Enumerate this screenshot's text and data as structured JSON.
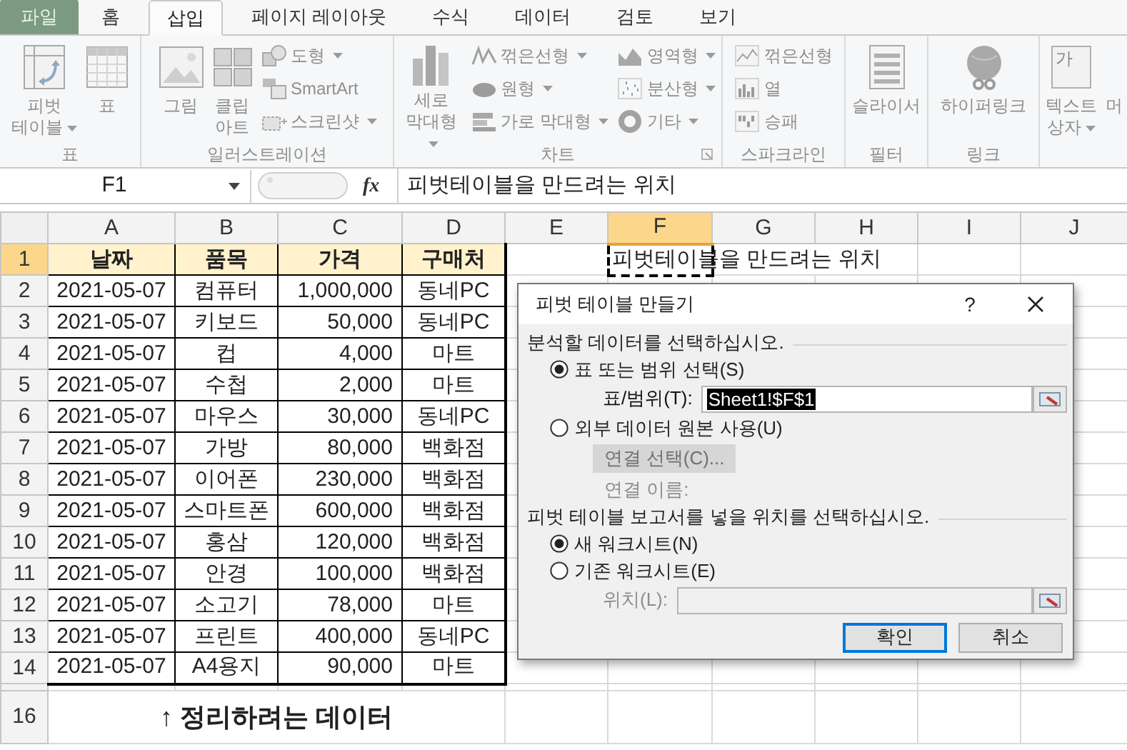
{
  "ribbon": {
    "disabled": true,
    "tabs": [
      {
        "label": "파일",
        "kind": "file",
        "selected": false
      },
      {
        "label": "홈",
        "kind": "tab",
        "selected": false
      },
      {
        "label": "삽입",
        "kind": "tab",
        "selected": true
      },
      {
        "label": "페이지 레이아웃",
        "kind": "tab",
        "selected": false
      },
      {
        "label": "수식",
        "kind": "tab",
        "selected": false
      },
      {
        "label": "데이터",
        "kind": "tab",
        "selected": false
      },
      {
        "label": "검토",
        "kind": "tab",
        "selected": false
      },
      {
        "label": "보기",
        "kind": "tab",
        "selected": false
      }
    ],
    "groups": [
      {
        "label": "표",
        "tools": [
          {
            "label": "피벗\n테이블",
            "kind": "large",
            "dropdown": true
          },
          {
            "label": "표",
            "kind": "large",
            "dropdown": false
          }
        ]
      },
      {
        "label": "일러스트레이션",
        "tools": [
          {
            "label": "그림",
            "kind": "large",
            "dropdown": false
          },
          {
            "label": "클립\n아트",
            "kind": "large",
            "dropdown": false
          },
          {
            "label": "도형",
            "kind": "small",
            "dropdown": true
          },
          {
            "label": "SmartArt",
            "kind": "small",
            "dropdown": false
          },
          {
            "label": "스크린샷",
            "kind": "small",
            "dropdown": true
          }
        ]
      },
      {
        "label": "차트",
        "launcher": true,
        "tools": [
          {
            "label": "세로\n막대형",
            "kind": "large",
            "dropdown": true
          },
          {
            "label": "꺾은선형",
            "kind": "small",
            "dropdown": true
          },
          {
            "label": "원형",
            "kind": "small",
            "dropdown": true
          },
          {
            "label": "가로 막대형",
            "kind": "small",
            "dropdown": true
          },
          {
            "label": "영역형",
            "kind": "small",
            "dropdown": true
          },
          {
            "label": "분산형",
            "kind": "small",
            "dropdown": true
          },
          {
            "label": "기타",
            "kind": "small",
            "dropdown": true
          }
        ]
      },
      {
        "label": "스파크라인",
        "tools": [
          {
            "label": "꺾은선형",
            "kind": "small",
            "dropdown": false
          },
          {
            "label": "열",
            "kind": "small",
            "dropdown": false
          },
          {
            "label": "승패",
            "kind": "small",
            "dropdown": false
          }
        ]
      },
      {
        "label": "필터",
        "tools": [
          {
            "label": "슬라이서",
            "kind": "large",
            "dropdown": false
          }
        ]
      },
      {
        "label": "링크",
        "tools": [
          {
            "label": "하이퍼링크",
            "kind": "large",
            "dropdown": false
          }
        ]
      },
      {
        "tools": [
          {
            "label": "텍스트\n상자",
            "kind": "large",
            "dropdown": true,
            "icon_letter": "가"
          },
          {
            "label": "머",
            "kind": "large",
            "dropdown": false
          }
        ]
      }
    ]
  },
  "formula_bar": {
    "name_box": "F1",
    "function_label": "fx",
    "formula": "피벗테이블을 만드려는 위치"
  },
  "sheet": {
    "columns": [
      {
        "label": "A",
        "selected": false
      },
      {
        "label": "B",
        "selected": false
      },
      {
        "label": "C",
        "selected": false
      },
      {
        "label": "D",
        "selected": false
      },
      {
        "label": "E",
        "selected": false
      },
      {
        "label": "F",
        "selected": true
      },
      {
        "label": "G",
        "selected": false
      },
      {
        "label": "H",
        "selected": false
      },
      {
        "label": "I",
        "selected": false
      },
      {
        "label": "J",
        "selected": false
      }
    ],
    "rows": [
      {
        "label": "1",
        "selected": true,
        "kind": "header",
        "cells": [
          "날짜",
          "품목",
          "가격",
          "구매처"
        ],
        "column_f_text": "피벗테이블을 만드려는 위치"
      },
      {
        "label": "2",
        "selected": false,
        "kind": "data",
        "cells": [
          "2021-05-07",
          "컴퓨터",
          "1,000,000",
          "동네PC"
        ]
      },
      {
        "label": "3",
        "selected": false,
        "kind": "data",
        "cells": [
          "2021-05-07",
          "키보드",
          "50,000",
          "동네PC"
        ]
      },
      {
        "label": "4",
        "selected": false,
        "kind": "data",
        "cells": [
          "2021-05-07",
          "컵",
          "4,000",
          "마트"
        ]
      },
      {
        "label": "5",
        "selected": false,
        "kind": "data",
        "cells": [
          "2021-05-07",
          "수첩",
          "2,000",
          "마트"
        ]
      },
      {
        "label": "6",
        "selected": false,
        "kind": "data",
        "cells": [
          "2021-05-07",
          "마우스",
          "30,000",
          "동네PC"
        ]
      },
      {
        "label": "7",
        "selected": false,
        "kind": "data",
        "cells": [
          "2021-05-07",
          "가방",
          "80,000",
          "백화점"
        ]
      },
      {
        "label": "8",
        "selected": false,
        "kind": "data",
        "cells": [
          "2021-05-07",
          "이어폰",
          "230,000",
          "백화점"
        ]
      },
      {
        "label": "9",
        "selected": false,
        "kind": "data",
        "cells": [
          "2021-05-07",
          "스마트폰",
          "600,000",
          "백화점"
        ]
      },
      {
        "label": "10",
        "selected": false,
        "kind": "data",
        "cells": [
          "2021-05-07",
          "홍삼",
          "120,000",
          "백화점"
        ]
      },
      {
        "label": "11",
        "selected": false,
        "kind": "data",
        "cells": [
          "2021-05-07",
          "안경",
          "100,000",
          "백화점"
        ]
      },
      {
        "label": "12",
        "selected": false,
        "kind": "data",
        "cells": [
          "2021-05-07",
          "소고기",
          "78,000",
          "마트"
        ]
      },
      {
        "label": "13",
        "selected": false,
        "kind": "data",
        "cells": [
          "2021-05-07",
          "프린트",
          "400,000",
          "동네PC"
        ]
      },
      {
        "label": "14",
        "selected": false,
        "kind": "data",
        "cells": [
          "2021-05-07",
          "A4용지",
          "90,000",
          "마트"
        ]
      },
      {
        "label": "16",
        "selected": false,
        "kind": "note",
        "text": "↑ 정리하려는 데이터"
      }
    ]
  },
  "dialog": {
    "title": "피벗 테이블 만들기",
    "help_label": "?",
    "items": [
      {
        "kind": "heading",
        "text": "분석할 데이터를 선택하십시오."
      },
      {
        "kind": "radio",
        "label": "표 또는 범위 선택(S)",
        "selected": true
      },
      {
        "kind": "field",
        "label": "표/범위(T):",
        "value": "Sheet1!$F$1",
        "highlighted": true,
        "disabled": false
      },
      {
        "kind": "radio",
        "label": "외부 데이터 원본 사용(U)",
        "selected": false
      },
      {
        "kind": "button",
        "label": "연결 선택(C)...",
        "disabled": true
      },
      {
        "kind": "note",
        "text": "연결 이름:",
        "disabled": true
      },
      {
        "kind": "heading",
        "text": "피벗 테이블 보고서를 넣을 위치를 선택하십시오."
      },
      {
        "kind": "radio",
        "label": "새 워크시트(N)",
        "selected": true
      },
      {
        "kind": "radio",
        "label": "기존 워크시트(E)",
        "selected": false
      },
      {
        "kind": "field",
        "label": "위치(L):",
        "disabled": true
      }
    ],
    "buttons": [
      {
        "label": "확인",
        "default": true
      },
      {
        "label": "취소",
        "default": false
      }
    ]
  }
}
